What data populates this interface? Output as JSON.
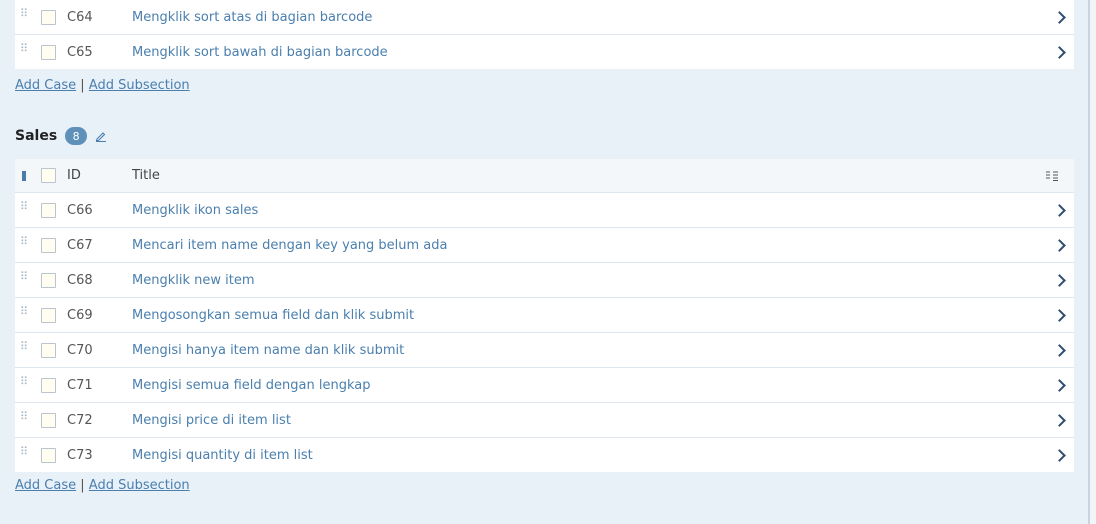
{
  "upper_section": {
    "rows": [
      {
        "id": "C64",
        "title": "Mengklik sort atas di bagian barcode"
      },
      {
        "id": "C65",
        "title": "Mengklik sort bawah di bagian barcode"
      }
    ],
    "add_case": "Add Case",
    "separator": "|",
    "add_subsection": "Add Subsection"
  },
  "sales_section": {
    "name": "Sales",
    "count": "8",
    "header": {
      "id": "ID",
      "title": "Title"
    },
    "rows": [
      {
        "id": "C66",
        "title": "Mengklik ikon sales"
      },
      {
        "id": "C67",
        "title": "Mencari item name dengan key yang belum ada"
      },
      {
        "id": "C68",
        "title": "Mengklik new item"
      },
      {
        "id": "C69",
        "title": "Mengosongkan semua field dan klik submit"
      },
      {
        "id": "C70",
        "title": "Mengisi hanya item name dan klik submit"
      },
      {
        "id": "C71",
        "title": "Mengisi semua field dengan lengkap"
      },
      {
        "id": "C72",
        "title": "Mengisi price di item list"
      },
      {
        "id": "C73",
        "title": "Mengisi quantity di item list"
      }
    ],
    "add_case": "Add Case",
    "separator": "|",
    "add_subsection": "Add Subsection"
  },
  "colors": {
    "background": "#e8f0f8",
    "link": "#4a7fae",
    "badge": "#5e90ba"
  }
}
